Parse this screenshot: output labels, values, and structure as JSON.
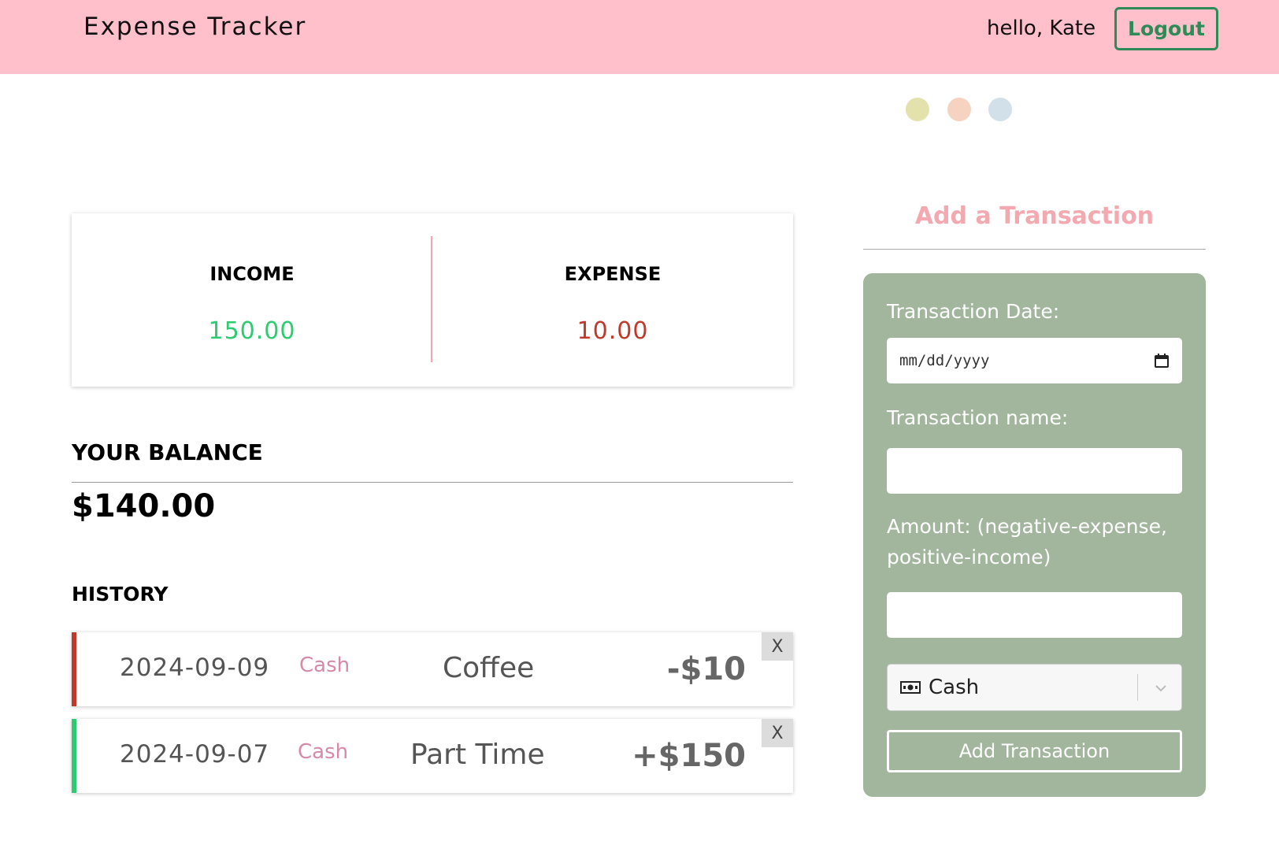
{
  "header": {
    "title": "Expense Tracker",
    "greeting": "hello, Kate",
    "logout_label": "Logout"
  },
  "theme_dots": [
    {
      "color": "#e3e2ad"
    },
    {
      "color": "#f6d2c1"
    },
    {
      "color": "#d2e0ea"
    }
  ],
  "summary": {
    "income_label": "INCOME",
    "income_value": "150.00",
    "expense_label": "EXPENSE",
    "expense_value": "10.00"
  },
  "balance": {
    "label": "YOUR BALANCE",
    "value": "$140.00"
  },
  "history": {
    "label": "HISTORY",
    "items": [
      {
        "date": "2024-09-09",
        "method": "Cash",
        "name": "Coffee",
        "amount": "-$10",
        "type": "expense",
        "delete_label": "X"
      },
      {
        "date": "2024-09-07",
        "method": "Cash",
        "name": "Part Time",
        "amount": "+$150",
        "type": "income",
        "delete_label": "X"
      }
    ]
  },
  "form": {
    "heading": "Add a Transaction",
    "date_label": "Transaction Date:",
    "date_placeholder": "mm/dd/yyyy",
    "name_label": "Transaction name:",
    "name_value": "",
    "amount_label": "Amount: (negative-expense, positive-income)",
    "amount_value": "",
    "method_selected": "Cash",
    "submit_label": "Add Transaction"
  },
  "colors": {
    "header_bg": "#ffc0cb",
    "logout_accent": "#2e8b57",
    "income": "#2ecc71",
    "expense": "#c0392b",
    "form_panel": "#a2b59d",
    "form_heading": "#f4a8b0",
    "method_text": "#d68aa8"
  },
  "icons": {
    "calendar": "calendar-icon",
    "cash": "cash-icon",
    "chevron": "chevron-down-icon"
  }
}
